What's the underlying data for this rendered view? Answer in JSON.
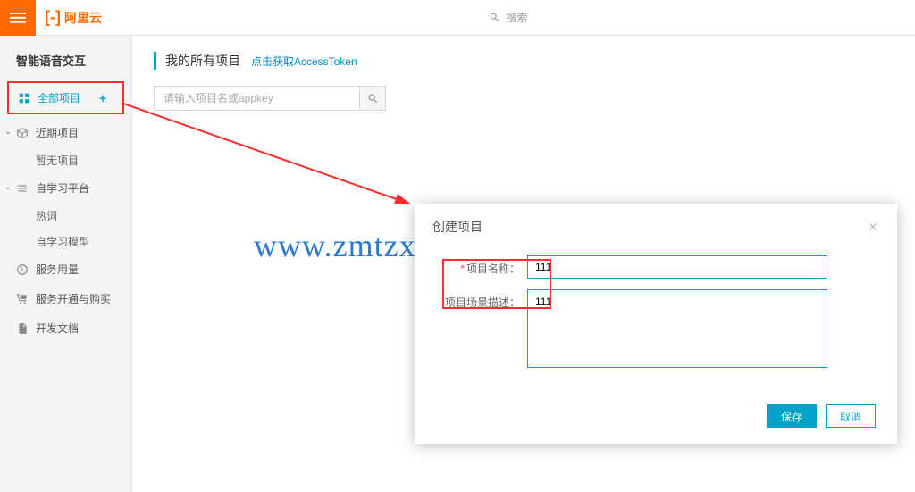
{
  "header": {
    "logo_text": "阿里云",
    "search_placeholder": "搜索"
  },
  "sidebar": {
    "title": "智能语音交互",
    "all_projects": "全部项目",
    "recent_projects": "近期项目",
    "recent_empty": "暂无项目",
    "self_learn": "自学习平台",
    "hotword": "热词",
    "self_model": "自学习模型",
    "usage": "服务用量",
    "activate": "服务开通与购买",
    "docs": "开发文档"
  },
  "main": {
    "title": "我的所有项目",
    "token_link": "点击获取AccessToken",
    "search_placeholder": "请输入项目名或appkey"
  },
  "modal": {
    "title": "创建项目",
    "name_label": "项目名称：",
    "name_value": "111",
    "scene_label": "项目场景描述：",
    "scene_value": "111",
    "save_btn": "保存",
    "cancel_btn": "取消"
  },
  "watermark": "www.zmtzxw.com"
}
